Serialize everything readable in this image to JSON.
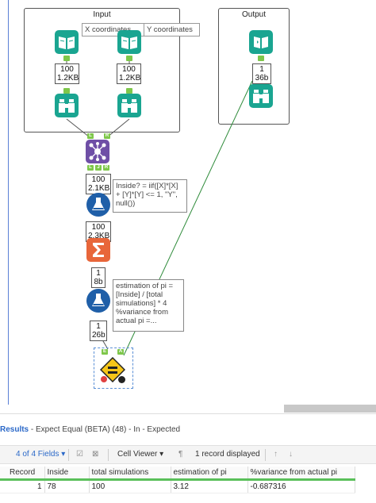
{
  "containers": {
    "input": {
      "title": "Input"
    },
    "output": {
      "title": "Output"
    }
  },
  "tool_labels": {
    "x_coords": "X coordinates",
    "y_coords": "Y coordinates"
  },
  "metrics": {
    "input_x": {
      "line1": "100",
      "line2": "1.2KB"
    },
    "input_y": {
      "line1": "100",
      "line2": "1.2KB"
    },
    "output": {
      "line1": "1",
      "line2": "36b"
    },
    "join": {
      "line1": "100",
      "line2": "2.1KB"
    },
    "formula1": {
      "line1": "100",
      "line2": "2.3KB"
    },
    "summarize": {
      "line1": "1",
      "line2": "8b"
    },
    "formula2": {
      "line1": "1",
      "line2": "26b"
    }
  },
  "annotations": {
    "formula1": "Inside? = iif([X]*[X]\n+ [Y]*[Y] <= 1, \"Y\",\nnull())",
    "formula2": "estimation of pi =\n[Inside] / [total\nsimulations] * 4\n%variance from\nactual pi =..."
  },
  "join_anchors": {
    "left": "L",
    "right": "R",
    "j": "J",
    "top_left": "L",
    "top_right": "R"
  },
  "expect_anchors": {
    "e": "E",
    "a": "A"
  },
  "results": {
    "prefix": "Results",
    "title": " - Expect Equal (BETA) (48) - In - Expected",
    "fields_label": "4 of 4 Fields",
    "viewer_label": "Cell Viewer",
    "records_label": "1 record displayed",
    "columns": [
      "Record",
      "Inside",
      "total simulations",
      "estimation of pi",
      "%variance from actual pi"
    ],
    "rows": [
      [
        "1",
        "78",
        "100",
        "3.12",
        "-0.687316"
      ]
    ]
  },
  "colors": {
    "teal": "#1aa591",
    "teal_dark": "#14806f",
    "purple": "#6f4fa6",
    "blue_formula": "#1f5fa8",
    "orange_sum": "#e8663a",
    "anchor_green": "#7ec74a",
    "wire_green": "#2e8b3a",
    "expect_yellow": "#f5c518"
  },
  "icons": {
    "input_x": "book-open-icon",
    "input_y": "book-open-icon",
    "output": "book-output-icon",
    "browse": "binoculars-icon",
    "join": "join-hub-icon",
    "formula": "flask-icon",
    "summarize": "sigma-icon",
    "expect": "expect-equal-sign-icon"
  }
}
